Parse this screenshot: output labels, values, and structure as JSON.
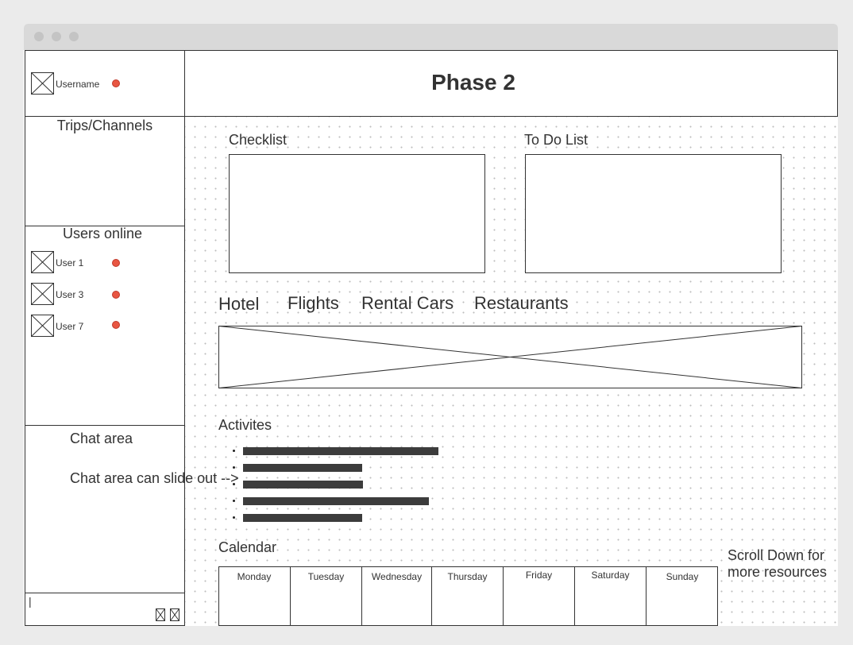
{
  "window": {
    "dots": [
      "close",
      "minimize",
      "maximize"
    ]
  },
  "header": {
    "title": "Phase 2",
    "username": "Username"
  },
  "sidebar": {
    "trips_title": "Trips/Channels",
    "users_title": "Users online",
    "users": [
      {
        "name": "User 1"
      },
      {
        "name": "User 3"
      },
      {
        "name": "User 7"
      }
    ],
    "chat_title": "Chat area",
    "chat_note": "Chat area can slide out -->",
    "chat_input_value": "|"
  },
  "main": {
    "checklist_label": "Checklist",
    "todo_label": "To Do List",
    "tabs": [
      "Hotel",
      "Flights",
      "Rental Cars",
      "Restaurants"
    ],
    "activities_label": "Activites",
    "activities": [
      {
        "bar_fraction": 1.0
      },
      {
        "bar_fraction": 0.61
      },
      {
        "bar_fraction": 0.615
      },
      {
        "bar_fraction": 0.95
      },
      {
        "bar_fraction": 0.61
      }
    ],
    "calendar_label": "Calendar",
    "days": [
      "Monday",
      "Tuesday",
      "Wednesday",
      "Thursday",
      "Friday",
      "Saturday",
      "Sunday"
    ],
    "scroll_note_line1": "Scroll Down for",
    "scroll_note_line2": "more resources"
  },
  "colors": {
    "status_online": "#e85642",
    "bar": "#3c3c3c"
  },
  "icons": {
    "placeholder": "image-placeholder-icon"
  }
}
